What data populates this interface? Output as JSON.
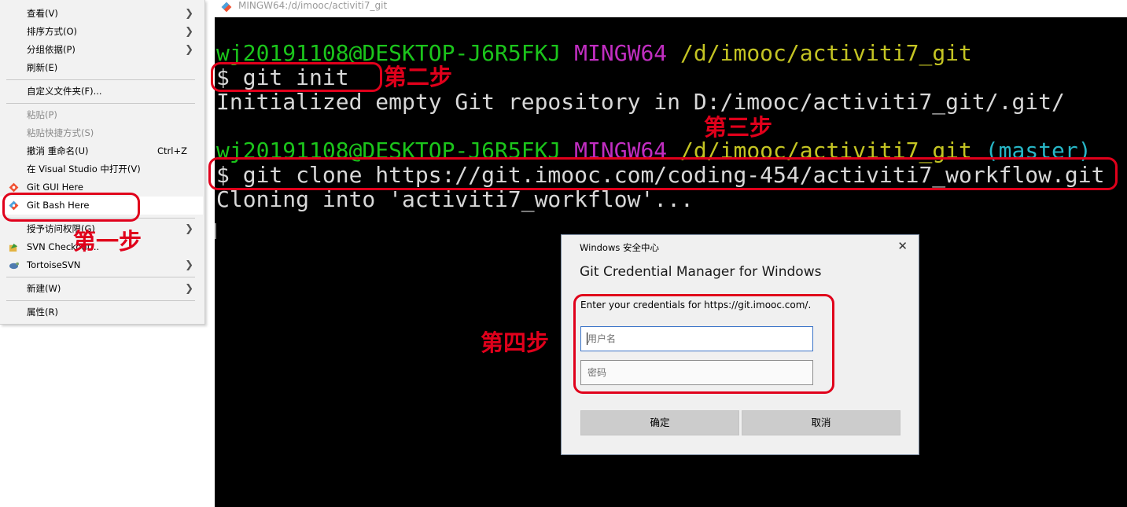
{
  "context_menu": {
    "items": [
      {
        "label": "查看(V)",
        "submenu": true
      },
      {
        "label": "排序方式(O)",
        "submenu": true
      },
      {
        "label": "分组依据(P)",
        "submenu": true
      },
      {
        "label": "刷新(E)"
      },
      {
        "label": "自定义文件夹(F)..."
      },
      {
        "label": "粘贴(P)",
        "disabled": true
      },
      {
        "label": "粘贴快捷方式(S)",
        "disabled": true
      },
      {
        "label": "撤消 重命名(U)",
        "shortcut": "Ctrl+Z"
      },
      {
        "label": "在 Visual Studio 中打开(V)"
      },
      {
        "label": "Git GUI Here",
        "icon": "git-icon"
      },
      {
        "label": "Git Bash Here",
        "icon": "git-icon"
      },
      {
        "label": "授予访问权限(G)",
        "submenu": true
      },
      {
        "label": "SVN Checkout...",
        "icon": "svn-checkout-icon"
      },
      {
        "label": "TortoiseSVN",
        "icon": "tortoisesvn-icon",
        "submenu": true
      },
      {
        "label": "新建(W)",
        "submenu": true
      },
      {
        "label": "属性(R)"
      }
    ]
  },
  "terminal": {
    "window_title": "MINGW64:/d/imooc/activiti7_git",
    "prompt1": {
      "user": "wj20191108@DESKTOP-J6R5FKJ",
      "env": "MINGW64",
      "path": "/d/imooc/activiti7_git"
    },
    "cmd1": "$ git init",
    "out1": "Initialized empty Git repository in D:/imooc/activiti7_git/.git/",
    "prompt2": {
      "user": "wj20191108@DESKTOP-J6R5FKJ",
      "env": "MINGW64",
      "path": "/d/imooc/activiti7_git",
      "branch": "(master)"
    },
    "cmd2": "$ git clone https://git.imooc.com/coding-454/activiti7_workflow.git",
    "out2": "Cloning into 'activiti7_workflow'..."
  },
  "annotations": {
    "step1": "第一步",
    "step2": "第二步",
    "step3": "第三步",
    "step4": "第四步",
    "color": "#e0001b"
  },
  "dialog": {
    "window_title": "Windows 安全中心",
    "heading": "Git Credential Manager for Windows",
    "prompt": "Enter your credentials for https://git.imooc.com/.",
    "username_placeholder": "用户名",
    "password_placeholder": "密码",
    "ok": "确定",
    "cancel": "取消"
  }
}
